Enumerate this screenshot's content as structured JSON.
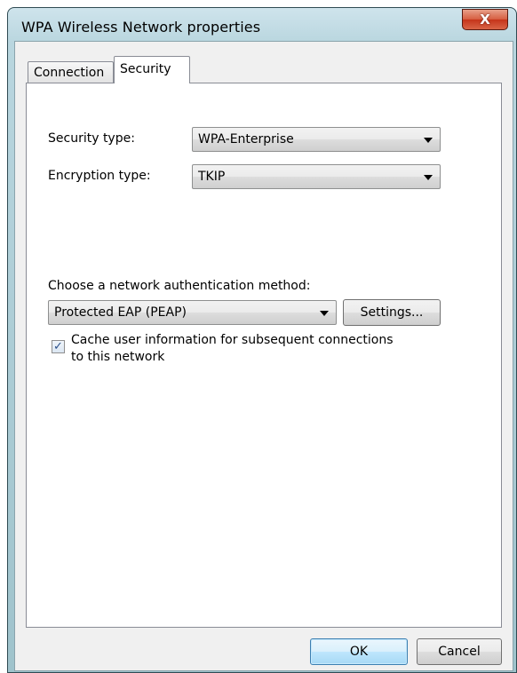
{
  "window": {
    "title": "WPA Wireless Network properties",
    "close_glyph": "X"
  },
  "tabs": [
    {
      "label": "Connection",
      "selected": false
    },
    {
      "label": "Security",
      "selected": true
    }
  ],
  "security": {
    "security_type_label": "Security type:",
    "security_type_value": "WPA-Enterprise",
    "encryption_type_label": "Encryption type:",
    "encryption_type_value": "TKIP",
    "auth_method_label": "Choose a network authentication method:",
    "auth_method_value": "Protected EAP (PEAP)",
    "settings_button": "Settings...",
    "cache_checkbox_label_line1": "Cache user information for subsequent connections",
    "cache_checkbox_label_line2": "to this network",
    "cache_checked": true
  },
  "footer": {
    "ok_label": "OK",
    "cancel_label": "Cancel"
  },
  "icons": [
    "close-icon",
    "dropdown-arrow-icon",
    "checkmark-icon"
  ],
  "colors": {
    "titlebar": "#b9d6df",
    "close_button": "#c5341a",
    "dialog_background": "#f0f0f0",
    "default_button": "#bee6fd"
  }
}
